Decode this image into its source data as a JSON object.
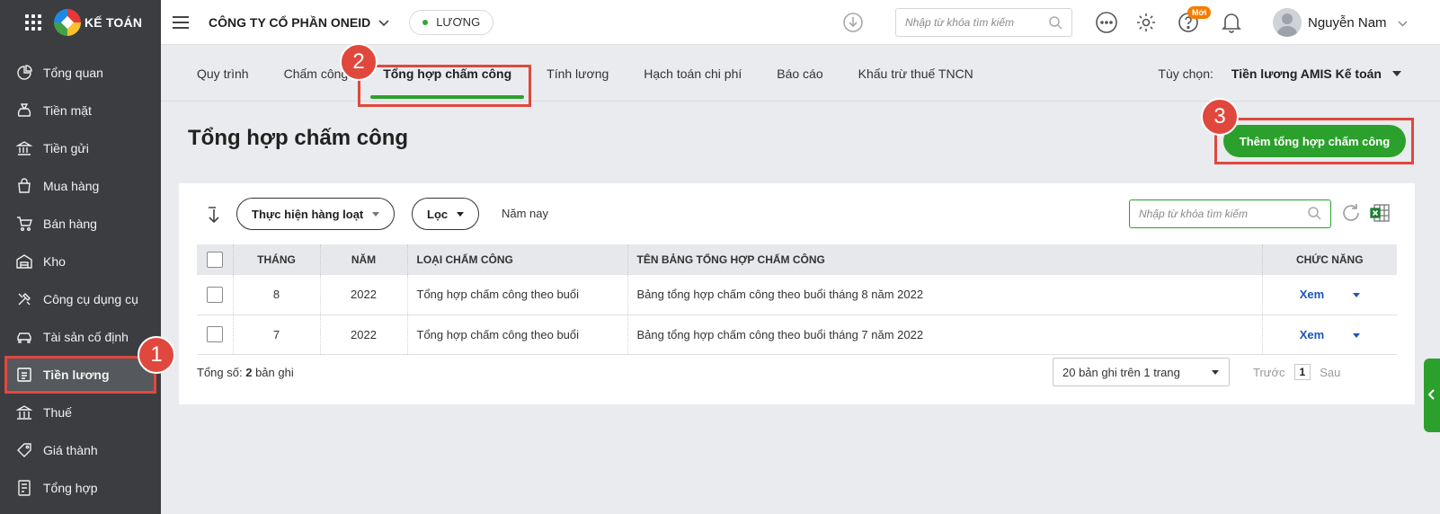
{
  "app": {
    "logo_text": "KẾ TOÁN"
  },
  "sidebar": {
    "items": [
      {
        "label": "Tổng quan",
        "icon": "dashboard-icon"
      },
      {
        "label": "Tiền mặt",
        "icon": "money-bag-icon"
      },
      {
        "label": "Tiền gửi",
        "icon": "bank-icon"
      },
      {
        "label": "Mua hàng",
        "icon": "shopping-bag-icon"
      },
      {
        "label": "Bán hàng",
        "icon": "cart-icon"
      },
      {
        "label": "Kho",
        "icon": "warehouse-icon"
      },
      {
        "label": "Công cụ dụng cụ",
        "icon": "tools-icon"
      },
      {
        "label": "Tài sản cố định",
        "icon": "car-icon"
      },
      {
        "label": "Tiền lương",
        "icon": "salary-icon",
        "active": true
      },
      {
        "label": "Thuế",
        "icon": "tax-building-icon"
      },
      {
        "label": "Giá thành",
        "icon": "price-tag-icon"
      },
      {
        "label": "Tổng hợp",
        "icon": "report-icon"
      }
    ]
  },
  "header": {
    "company": "CÔNG TY CỔ PHẦN ONEID",
    "module": "LƯƠNG",
    "search_placeholder": "Nhập từ khóa tìm kiếm",
    "new_badge": "Mới",
    "user_name": "Nguyễn Nam"
  },
  "tabs": [
    {
      "label": "Quy trình"
    },
    {
      "label": "Chấm công"
    },
    {
      "label": "Tổng hợp chấm công",
      "active": true
    },
    {
      "label": "Tính lương"
    },
    {
      "label": "Hạch toán chi phí"
    },
    {
      "label": "Báo cáo"
    },
    {
      "label": "Khấu trừ thuế TNCN"
    }
  ],
  "options": {
    "label": "Tùy chọn:",
    "value": "Tiền lương AMIS Kế toán"
  },
  "page": {
    "title": "Tổng hợp chấm công",
    "add_button": "Thêm tổng hợp chấm công"
  },
  "toolbar": {
    "batch_action": "Thực hiện hàng loạt",
    "filter": "Lọc",
    "period": "Năm nay",
    "search_placeholder": "Nhập từ khóa tìm kiếm"
  },
  "table": {
    "columns": [
      "THÁNG",
      "NĂM",
      "LOẠI CHẤM CÔNG",
      "TÊN BẢNG TỔNG HỢP CHẤM CÔNG",
      "CHỨC NĂNG"
    ],
    "rows": [
      {
        "month": "8",
        "year": "2022",
        "type": "Tổng hợp chấm công theo buổi",
        "name": "Bảng tổng hợp chấm công theo buổi tháng 8 năm 2022",
        "action": "Xem"
      },
      {
        "month": "7",
        "year": "2022",
        "type": "Tổng hợp chấm công theo buổi",
        "name": "Bảng tổng hợp chấm công theo buổi tháng 7 năm 2022",
        "action": "Xem"
      }
    ]
  },
  "footer": {
    "total_label": "Tổng số:",
    "total_count": "2",
    "total_unit": "bản ghi",
    "page_size": "20 bản ghi trên 1 trang",
    "prev": "Trước",
    "page": "1",
    "next": "Sau"
  },
  "markers": [
    "1",
    "2",
    "3"
  ],
  "colors": {
    "accent": "#2ca02c",
    "highlight": "#e0483e",
    "sidebar": "#3b3d40",
    "link": "#1a55b8"
  }
}
